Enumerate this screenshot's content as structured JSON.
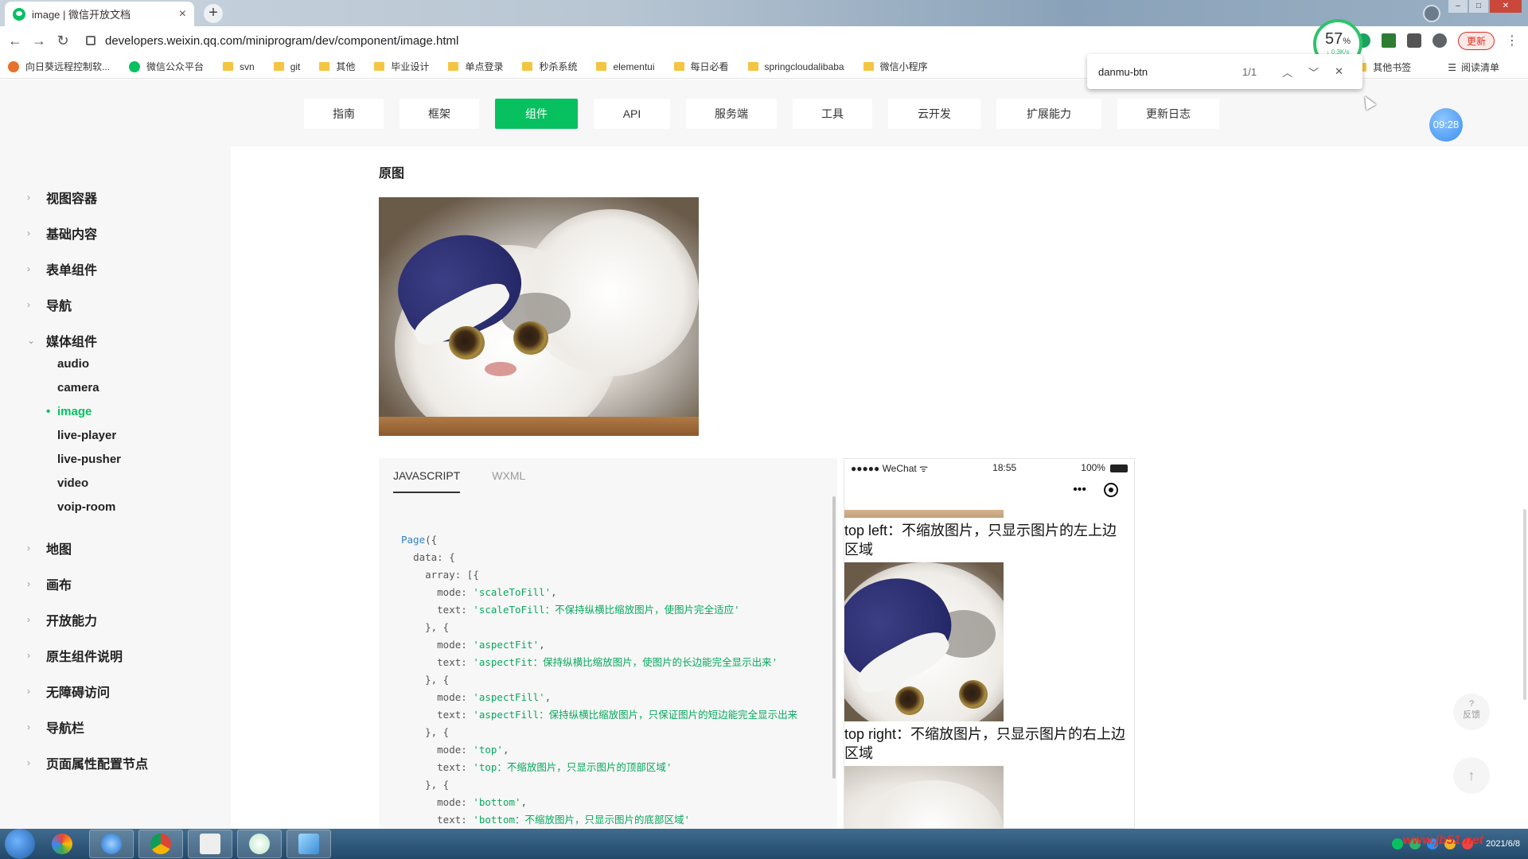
{
  "browser": {
    "tab_title": "image | 微信开放文档",
    "new_tab": "+",
    "tab_close": "×",
    "url": "developers.weixin.qq.com/miniprogram/dev/component/image.html",
    "speed_percent": "57",
    "speed_unit": "%",
    "speed_rate": "↓ 0.3K/s",
    "update_label": "更新",
    "bookmarks": [
      "向日葵远程控制软...",
      "微信公众平台",
      "svn",
      "git",
      "其他",
      "毕业设计",
      "单点登录",
      "秒杀系统",
      "elementui",
      "每日必看",
      "springcloudalibaba",
      "微信小程序"
    ],
    "bookmarks_right": [
      "其他书签",
      "阅读清单"
    ]
  },
  "find_bar": {
    "query": "danmu-btn",
    "count": "1/1"
  },
  "topnav": {
    "tabs": [
      "指南",
      "框架",
      "组件",
      "API",
      "服务端",
      "工具",
      "云开发",
      "扩展能力",
      "更新日志"
    ],
    "active_index": 2,
    "timer": "09:28"
  },
  "sidebar": {
    "items": [
      "视图容器",
      "基础内容",
      "表单组件",
      "导航",
      "媒体组件",
      "地图",
      "画布",
      "开放能力",
      "原生组件说明",
      "无障碍访问",
      "导航栏",
      "页面属性配置节点"
    ],
    "sub_items": [
      "audio",
      "camera",
      "image",
      "live-player",
      "live-pusher",
      "video",
      "voip-room"
    ],
    "active_sub": "image"
  },
  "main": {
    "heading": "原图"
  },
  "code": {
    "tabs": [
      "JAVASCRIPT",
      "WXML"
    ],
    "active_tab": "JAVASCRIPT",
    "lines": [
      {
        "indent": 0,
        "parts": [
          {
            "t": "kw",
            "v": "Page"
          },
          {
            "t": "p",
            "v": "({"
          }
        ]
      },
      {
        "indent": 1,
        "parts": [
          {
            "t": "p",
            "v": "data: {"
          }
        ]
      },
      {
        "indent": 2,
        "parts": [
          {
            "t": "p",
            "v": "array: [{"
          }
        ]
      },
      {
        "indent": 3,
        "parts": [
          {
            "t": "p",
            "v": "mode: "
          },
          {
            "t": "str",
            "v": "'scaleToFill'"
          },
          {
            "t": "p",
            "v": ","
          }
        ]
      },
      {
        "indent": 3,
        "parts": [
          {
            "t": "p",
            "v": "text: "
          },
          {
            "t": "str",
            "v": "'scaleToFill：不保持纵横比缩放图片，使图片完全适应'"
          }
        ]
      },
      {
        "indent": 2,
        "parts": [
          {
            "t": "p",
            "v": "}, {"
          }
        ]
      },
      {
        "indent": 3,
        "parts": [
          {
            "t": "p",
            "v": "mode: "
          },
          {
            "t": "str",
            "v": "'aspectFit'"
          },
          {
            "t": "p",
            "v": ","
          }
        ]
      },
      {
        "indent": 3,
        "parts": [
          {
            "t": "p",
            "v": "text: "
          },
          {
            "t": "str",
            "v": "'aspectFit：保持纵横比缩放图片，使图片的长边能完全显示出来'"
          }
        ]
      },
      {
        "indent": 2,
        "parts": [
          {
            "t": "p",
            "v": "}, {"
          }
        ]
      },
      {
        "indent": 3,
        "parts": [
          {
            "t": "p",
            "v": "mode: "
          },
          {
            "t": "str",
            "v": "'aspectFill'"
          },
          {
            "t": "p",
            "v": ","
          }
        ]
      },
      {
        "indent": 3,
        "parts": [
          {
            "t": "p",
            "v": "text: "
          },
          {
            "t": "str",
            "v": "'aspectFill：保持纵横比缩放图片，只保证图片的短边能完全显示出来"
          }
        ]
      },
      {
        "indent": 2,
        "parts": [
          {
            "t": "p",
            "v": "}, {"
          }
        ]
      },
      {
        "indent": 3,
        "parts": [
          {
            "t": "p",
            "v": "mode: "
          },
          {
            "t": "str",
            "v": "'top'"
          },
          {
            "t": "p",
            "v": ","
          }
        ]
      },
      {
        "indent": 3,
        "parts": [
          {
            "t": "p",
            "v": "text: "
          },
          {
            "t": "str",
            "v": "'top：不缩放图片，只显示图片的顶部区域'"
          }
        ]
      },
      {
        "indent": 2,
        "parts": [
          {
            "t": "p",
            "v": "}, {"
          }
        ]
      },
      {
        "indent": 3,
        "parts": [
          {
            "t": "p",
            "v": "mode: "
          },
          {
            "t": "str",
            "v": "'bottom'"
          },
          {
            "t": "p",
            "v": ","
          }
        ]
      },
      {
        "indent": 3,
        "parts": [
          {
            "t": "p",
            "v": "text: "
          },
          {
            "t": "str",
            "v": "'bottom：不缩放图片，只显示图片的底部区域'"
          }
        ]
      }
    ]
  },
  "phone": {
    "carrier": "●●●●● WeChat",
    "wifi_icon": "wifi-icon",
    "time": "18:55",
    "battery": "100%",
    "menu_dots": "•••",
    "caption1": "top left：不缩放图片，只显示图片的左上边区域",
    "caption2": "top right：不缩放图片，只显示图片的右上边区域"
  },
  "page_widgets": {
    "feedback_mark": "?",
    "feedback": "反馈",
    "to_top": "↑"
  },
  "taskbar": {
    "date": "2021/6/8",
    "watermark": "www.jb51.net"
  },
  "colors": {
    "accent": "#07c160",
    "code_keyword": "#2c82c9",
    "code_string": "#07a85d"
  }
}
